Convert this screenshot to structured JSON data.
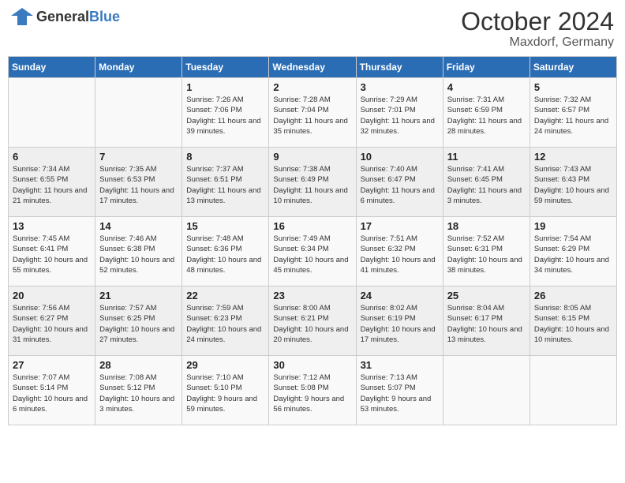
{
  "header": {
    "logo_general": "General",
    "logo_blue": "Blue",
    "month": "October 2024",
    "location": "Maxdorf, Germany"
  },
  "weekdays": [
    "Sunday",
    "Monday",
    "Tuesday",
    "Wednesday",
    "Thursday",
    "Friday",
    "Saturday"
  ],
  "weeks": [
    [
      {
        "day": "",
        "sunrise": "",
        "sunset": "",
        "daylight": ""
      },
      {
        "day": "",
        "sunrise": "",
        "sunset": "",
        "daylight": ""
      },
      {
        "day": "1",
        "sunrise": "Sunrise: 7:26 AM",
        "sunset": "Sunset: 7:06 PM",
        "daylight": "Daylight: 11 hours and 39 minutes."
      },
      {
        "day": "2",
        "sunrise": "Sunrise: 7:28 AM",
        "sunset": "Sunset: 7:04 PM",
        "daylight": "Daylight: 11 hours and 35 minutes."
      },
      {
        "day": "3",
        "sunrise": "Sunrise: 7:29 AM",
        "sunset": "Sunset: 7:01 PM",
        "daylight": "Daylight: 11 hours and 32 minutes."
      },
      {
        "day": "4",
        "sunrise": "Sunrise: 7:31 AM",
        "sunset": "Sunset: 6:59 PM",
        "daylight": "Daylight: 11 hours and 28 minutes."
      },
      {
        "day": "5",
        "sunrise": "Sunrise: 7:32 AM",
        "sunset": "Sunset: 6:57 PM",
        "daylight": "Daylight: 11 hours and 24 minutes."
      }
    ],
    [
      {
        "day": "6",
        "sunrise": "Sunrise: 7:34 AM",
        "sunset": "Sunset: 6:55 PM",
        "daylight": "Daylight: 11 hours and 21 minutes."
      },
      {
        "day": "7",
        "sunrise": "Sunrise: 7:35 AM",
        "sunset": "Sunset: 6:53 PM",
        "daylight": "Daylight: 11 hours and 17 minutes."
      },
      {
        "day": "8",
        "sunrise": "Sunrise: 7:37 AM",
        "sunset": "Sunset: 6:51 PM",
        "daylight": "Daylight: 11 hours and 13 minutes."
      },
      {
        "day": "9",
        "sunrise": "Sunrise: 7:38 AM",
        "sunset": "Sunset: 6:49 PM",
        "daylight": "Daylight: 11 hours and 10 minutes."
      },
      {
        "day": "10",
        "sunrise": "Sunrise: 7:40 AM",
        "sunset": "Sunset: 6:47 PM",
        "daylight": "Daylight: 11 hours and 6 minutes."
      },
      {
        "day": "11",
        "sunrise": "Sunrise: 7:41 AM",
        "sunset": "Sunset: 6:45 PM",
        "daylight": "Daylight: 11 hours and 3 minutes."
      },
      {
        "day": "12",
        "sunrise": "Sunrise: 7:43 AM",
        "sunset": "Sunset: 6:43 PM",
        "daylight": "Daylight: 10 hours and 59 minutes."
      }
    ],
    [
      {
        "day": "13",
        "sunrise": "Sunrise: 7:45 AM",
        "sunset": "Sunset: 6:41 PM",
        "daylight": "Daylight: 10 hours and 55 minutes."
      },
      {
        "day": "14",
        "sunrise": "Sunrise: 7:46 AM",
        "sunset": "Sunset: 6:38 PM",
        "daylight": "Daylight: 10 hours and 52 minutes."
      },
      {
        "day": "15",
        "sunrise": "Sunrise: 7:48 AM",
        "sunset": "Sunset: 6:36 PM",
        "daylight": "Daylight: 10 hours and 48 minutes."
      },
      {
        "day": "16",
        "sunrise": "Sunrise: 7:49 AM",
        "sunset": "Sunset: 6:34 PM",
        "daylight": "Daylight: 10 hours and 45 minutes."
      },
      {
        "day": "17",
        "sunrise": "Sunrise: 7:51 AM",
        "sunset": "Sunset: 6:32 PM",
        "daylight": "Daylight: 10 hours and 41 minutes."
      },
      {
        "day": "18",
        "sunrise": "Sunrise: 7:52 AM",
        "sunset": "Sunset: 6:31 PM",
        "daylight": "Daylight: 10 hours and 38 minutes."
      },
      {
        "day": "19",
        "sunrise": "Sunrise: 7:54 AM",
        "sunset": "Sunset: 6:29 PM",
        "daylight": "Daylight: 10 hours and 34 minutes."
      }
    ],
    [
      {
        "day": "20",
        "sunrise": "Sunrise: 7:56 AM",
        "sunset": "Sunset: 6:27 PM",
        "daylight": "Daylight: 10 hours and 31 minutes."
      },
      {
        "day": "21",
        "sunrise": "Sunrise: 7:57 AM",
        "sunset": "Sunset: 6:25 PM",
        "daylight": "Daylight: 10 hours and 27 minutes."
      },
      {
        "day": "22",
        "sunrise": "Sunrise: 7:59 AM",
        "sunset": "Sunset: 6:23 PM",
        "daylight": "Daylight: 10 hours and 24 minutes."
      },
      {
        "day": "23",
        "sunrise": "Sunrise: 8:00 AM",
        "sunset": "Sunset: 6:21 PM",
        "daylight": "Daylight: 10 hours and 20 minutes."
      },
      {
        "day": "24",
        "sunrise": "Sunrise: 8:02 AM",
        "sunset": "Sunset: 6:19 PM",
        "daylight": "Daylight: 10 hours and 17 minutes."
      },
      {
        "day": "25",
        "sunrise": "Sunrise: 8:04 AM",
        "sunset": "Sunset: 6:17 PM",
        "daylight": "Daylight: 10 hours and 13 minutes."
      },
      {
        "day": "26",
        "sunrise": "Sunrise: 8:05 AM",
        "sunset": "Sunset: 6:15 PM",
        "daylight": "Daylight: 10 hours and 10 minutes."
      }
    ],
    [
      {
        "day": "27",
        "sunrise": "Sunrise: 7:07 AM",
        "sunset": "Sunset: 5:14 PM",
        "daylight": "Daylight: 10 hours and 6 minutes."
      },
      {
        "day": "28",
        "sunrise": "Sunrise: 7:08 AM",
        "sunset": "Sunset: 5:12 PM",
        "daylight": "Daylight: 10 hours and 3 minutes."
      },
      {
        "day": "29",
        "sunrise": "Sunrise: 7:10 AM",
        "sunset": "Sunset: 5:10 PM",
        "daylight": "Daylight: 9 hours and 59 minutes."
      },
      {
        "day": "30",
        "sunrise": "Sunrise: 7:12 AM",
        "sunset": "Sunset: 5:08 PM",
        "daylight": "Daylight: 9 hours and 56 minutes."
      },
      {
        "day": "31",
        "sunrise": "Sunrise: 7:13 AM",
        "sunset": "Sunset: 5:07 PM",
        "daylight": "Daylight: 9 hours and 53 minutes."
      },
      {
        "day": "",
        "sunrise": "",
        "sunset": "",
        "daylight": ""
      },
      {
        "day": "",
        "sunrise": "",
        "sunset": "",
        "daylight": ""
      }
    ]
  ]
}
